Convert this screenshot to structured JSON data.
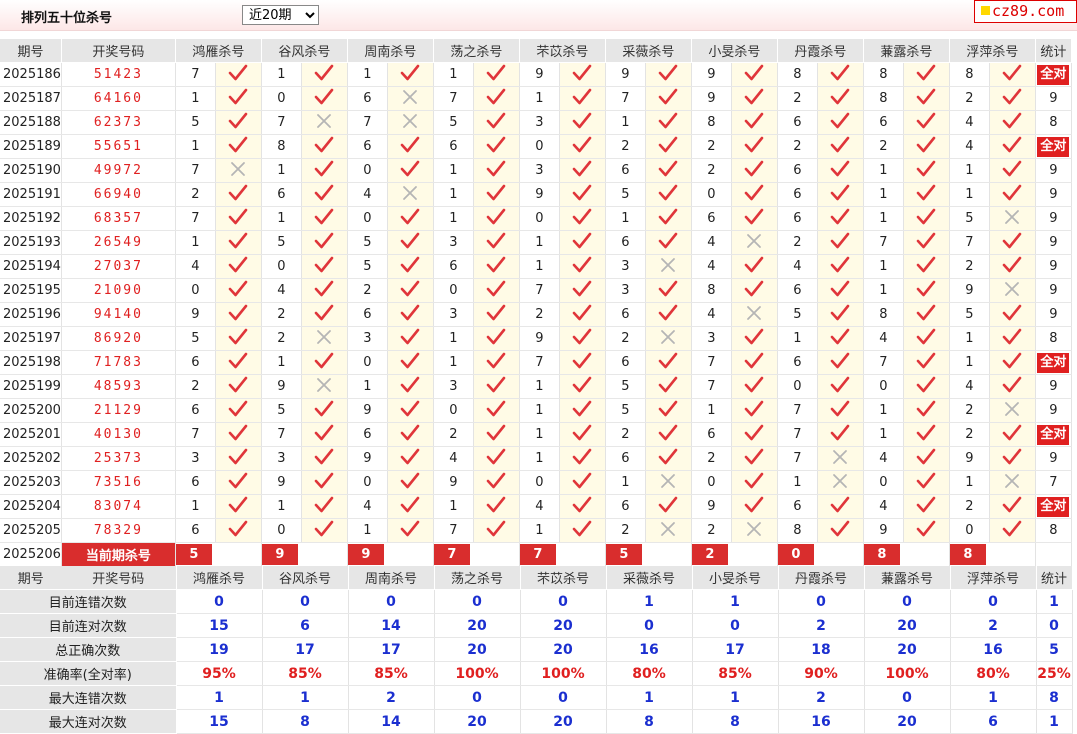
{
  "topbar": {
    "title": "排列五十位杀号",
    "period_select": "近20期",
    "period_options": [
      "近20期"
    ],
    "logo": "cz89.com"
  },
  "headers": {
    "period": "期号",
    "numbers": "开奖号码",
    "stat": "统计",
    "experts": [
      "鸿雁杀号",
      "谷风杀号",
      "周南杀号",
      "荡之杀号",
      "芣苡杀号",
      "采薇杀号",
      "小旻杀号",
      "丹霞杀号",
      "蒹露杀号",
      "浮萍杀号"
    ]
  },
  "rows": [
    {
      "period": "2025186",
      "numbers": "51423",
      "kills": [
        7,
        1,
        1,
        1,
        9,
        9,
        9,
        8,
        8,
        8
      ],
      "ok": [
        1,
        1,
        1,
        1,
        1,
        1,
        1,
        1,
        1,
        1
      ],
      "stat": "全对"
    },
    {
      "period": "2025187",
      "numbers": "64160",
      "kills": [
        1,
        0,
        6,
        7,
        1,
        7,
        9,
        2,
        8,
        2
      ],
      "ok": [
        1,
        1,
        0,
        1,
        1,
        1,
        1,
        1,
        1,
        1
      ],
      "stat": "9"
    },
    {
      "period": "2025188",
      "numbers": "62373",
      "kills": [
        5,
        7,
        7,
        5,
        3,
        1,
        8,
        6,
        6,
        4
      ],
      "ok": [
        1,
        0,
        0,
        1,
        1,
        1,
        1,
        1,
        1,
        1
      ],
      "stat": "8"
    },
    {
      "period": "2025189",
      "numbers": "55651",
      "kills": [
        1,
        8,
        6,
        6,
        0,
        2,
        2,
        2,
        2,
        4
      ],
      "ok": [
        1,
        1,
        1,
        1,
        1,
        1,
        1,
        1,
        1,
        1
      ],
      "stat": "全对"
    },
    {
      "period": "2025190",
      "numbers": "49972",
      "kills": [
        7,
        1,
        0,
        1,
        3,
        6,
        2,
        6,
        1,
        1
      ],
      "ok": [
        0,
        1,
        1,
        1,
        1,
        1,
        1,
        1,
        1,
        1
      ],
      "stat": "9"
    },
    {
      "period": "2025191",
      "numbers": "66940",
      "kills": [
        2,
        6,
        4,
        1,
        9,
        5,
        0,
        6,
        1,
        1
      ],
      "ok": [
        1,
        1,
        0,
        1,
        1,
        1,
        1,
        1,
        1,
        1
      ],
      "stat": "9"
    },
    {
      "period": "2025192",
      "numbers": "68357",
      "kills": [
        7,
        1,
        0,
        1,
        0,
        1,
        6,
        6,
        1,
        5
      ],
      "ok": [
        1,
        1,
        1,
        1,
        1,
        1,
        1,
        1,
        1,
        0
      ],
      "stat": "9"
    },
    {
      "period": "2025193",
      "numbers": "26549",
      "kills": [
        1,
        5,
        5,
        3,
        1,
        6,
        4,
        2,
        7,
        7
      ],
      "ok": [
        1,
        1,
        1,
        1,
        1,
        1,
        0,
        1,
        1,
        1
      ],
      "stat": "9"
    },
    {
      "period": "2025194",
      "numbers": "27037",
      "kills": [
        4,
        0,
        5,
        6,
        1,
        3,
        4,
        4,
        1,
        2
      ],
      "ok": [
        1,
        1,
        1,
        1,
        1,
        0,
        1,
        1,
        1,
        1
      ],
      "stat": "9"
    },
    {
      "period": "2025195",
      "numbers": "21090",
      "kills": [
        0,
        4,
        2,
        0,
        7,
        3,
        8,
        6,
        1,
        9
      ],
      "ok": [
        1,
        1,
        1,
        1,
        1,
        1,
        1,
        1,
        1,
        0
      ],
      "stat": "9"
    },
    {
      "period": "2025196",
      "numbers": "94140",
      "kills": [
        9,
        2,
        6,
        3,
        2,
        6,
        4,
        5,
        8,
        5
      ],
      "ok": [
        1,
        1,
        1,
        1,
        1,
        1,
        0,
        1,
        1,
        1
      ],
      "stat": "9"
    },
    {
      "period": "2025197",
      "numbers": "86920",
      "kills": [
        5,
        2,
        3,
        1,
        9,
        2,
        3,
        1,
        4,
        1
      ],
      "ok": [
        1,
        0,
        1,
        1,
        1,
        0,
        1,
        1,
        1,
        1
      ],
      "stat": "8"
    },
    {
      "period": "2025198",
      "numbers": "71783",
      "kills": [
        6,
        1,
        0,
        1,
        7,
        6,
        7,
        6,
        7,
        1
      ],
      "ok": [
        1,
        1,
        1,
        1,
        1,
        1,
        1,
        1,
        1,
        1
      ],
      "stat": "全对"
    },
    {
      "period": "2025199",
      "numbers": "48593",
      "kills": [
        2,
        9,
        1,
        3,
        1,
        5,
        7,
        0,
        0,
        4
      ],
      "ok": [
        1,
        0,
        1,
        1,
        1,
        1,
        1,
        1,
        1,
        1
      ],
      "stat": "9"
    },
    {
      "period": "2025200",
      "numbers": "21129",
      "kills": [
        6,
        5,
        9,
        0,
        1,
        5,
        1,
        7,
        1,
        2
      ],
      "ok": [
        1,
        1,
        1,
        1,
        1,
        1,
        1,
        1,
        1,
        0
      ],
      "stat": "9"
    },
    {
      "period": "2025201",
      "numbers": "40130",
      "kills": [
        7,
        7,
        6,
        2,
        1,
        2,
        6,
        7,
        1,
        2
      ],
      "ok": [
        1,
        1,
        1,
        1,
        1,
        1,
        1,
        1,
        1,
        1
      ],
      "stat": "全对"
    },
    {
      "period": "2025202",
      "numbers": "25373",
      "kills": [
        3,
        3,
        9,
        4,
        1,
        6,
        2,
        7,
        4,
        9
      ],
      "ok": [
        1,
        1,
        1,
        1,
        1,
        1,
        1,
        0,
        1,
        1
      ],
      "stat": "9"
    },
    {
      "period": "2025203",
      "numbers": "73516",
      "kills": [
        6,
        9,
        0,
        9,
        0,
        1,
        0,
        1,
        0,
        1
      ],
      "ok": [
        1,
        1,
        1,
        1,
        1,
        0,
        1,
        0,
        1,
        0
      ],
      "stat": "7"
    },
    {
      "period": "2025204",
      "numbers": "83074",
      "kills": [
        1,
        1,
        4,
        1,
        4,
        6,
        9,
        6,
        4,
        2
      ],
      "ok": [
        1,
        1,
        1,
        1,
        1,
        1,
        1,
        1,
        1,
        1
      ],
      "stat": "全对"
    },
    {
      "period": "2025205",
      "numbers": "78329",
      "kills": [
        6,
        0,
        1,
        7,
        1,
        2,
        2,
        8,
        9,
        0
      ],
      "ok": [
        1,
        1,
        1,
        1,
        1,
        0,
        0,
        1,
        1,
        1
      ],
      "stat": "8"
    }
  ],
  "current": {
    "period": "2025206",
    "label": "当前期杀号",
    "kills": [
      5,
      9,
      9,
      7,
      7,
      5,
      2,
      0,
      8,
      8
    ]
  },
  "stats": [
    {
      "label": "目前连错次数",
      "values": [
        "0",
        "0",
        "0",
        "0",
        "0",
        "1",
        "1",
        "0",
        "0",
        "0",
        "1"
      ],
      "color": "blue"
    },
    {
      "label": "目前连对次数",
      "values": [
        "15",
        "6",
        "14",
        "20",
        "20",
        "0",
        "0",
        "2",
        "20",
        "2",
        "0"
      ],
      "color": "blue"
    },
    {
      "label": "总正确次数",
      "values": [
        "19",
        "17",
        "17",
        "20",
        "20",
        "16",
        "17",
        "18",
        "20",
        "16",
        "5"
      ],
      "color": "blue"
    },
    {
      "label": "准确率(全对率)",
      "values": [
        "95%",
        "85%",
        "85%",
        "100%",
        "100%",
        "80%",
        "85%",
        "90%",
        "100%",
        "80%",
        "25%"
      ],
      "color": "red"
    },
    {
      "label": "最大连错次数",
      "values": [
        "1",
        "1",
        "2",
        "0",
        "0",
        "1",
        "1",
        "2",
        "0",
        "1",
        "8"
      ],
      "color": "blue"
    },
    {
      "label": "最大连对次数",
      "values": [
        "15",
        "8",
        "14",
        "20",
        "20",
        "8",
        "8",
        "16",
        "20",
        "6",
        "1"
      ],
      "color": "blue"
    }
  ],
  "colors": {
    "accent_red": "#e02020",
    "check_red": "#e0353a",
    "cross_gray": "#b5b5b5",
    "value_blue": "#1b2fd0",
    "header_gray": "#e6e6e6"
  }
}
